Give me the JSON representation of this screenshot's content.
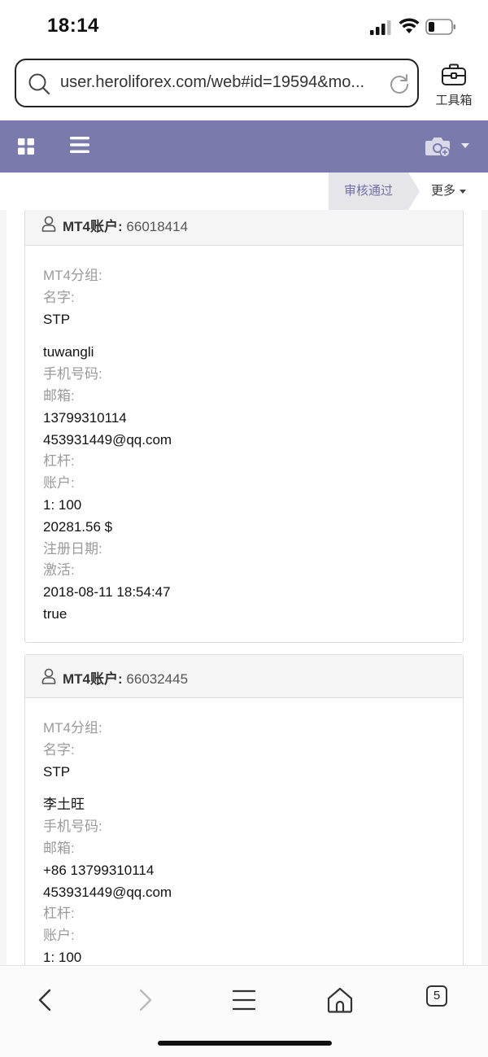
{
  "status": {
    "time": "18:14"
  },
  "browser": {
    "url": "user.heroliforex.com/web#id=19594&mo...",
    "toolbox_label": "工具箱"
  },
  "actions": {
    "approve": "审核通过",
    "more": "更多"
  },
  "accounts": [
    {
      "title_label": "MT4账户:",
      "number": "66018414",
      "lines": [
        {
          "text": "MT4分组:",
          "kind": "label"
        },
        {
          "text": "名字:",
          "kind": "label"
        },
        {
          "text": "STP",
          "kind": "value"
        },
        {
          "text": "tuwangli",
          "kind": "value",
          "gap": true
        },
        {
          "text": "手机号码:",
          "kind": "label"
        },
        {
          "text": "邮箱:",
          "kind": "label"
        },
        {
          "text": "13799310114",
          "kind": "value"
        },
        {
          "text": "453931449@qq.com",
          "kind": "value"
        },
        {
          "text": "杠杆:",
          "kind": "label"
        },
        {
          "text": "账户:",
          "kind": "label"
        },
        {
          "text": "1: 100",
          "kind": "value"
        },
        {
          "text": "20281.56 $",
          "kind": "value"
        },
        {
          "text": "注册日期:",
          "kind": "label"
        },
        {
          "text": "激活:",
          "kind": "label"
        },
        {
          "text": "2018-08-11 18:54:47",
          "kind": "value"
        },
        {
          "text": "true",
          "kind": "value"
        }
      ]
    },
    {
      "title_label": "MT4账户:",
      "number": "66032445",
      "lines": [
        {
          "text": "MT4分组:",
          "kind": "label"
        },
        {
          "text": "名字:",
          "kind": "label"
        },
        {
          "text": "STP",
          "kind": "value"
        },
        {
          "text": "李土旺",
          "kind": "value",
          "gap": true
        },
        {
          "text": "手机号码:",
          "kind": "label"
        },
        {
          "text": "邮箱:",
          "kind": "label"
        },
        {
          "text": "+86 13799310114",
          "kind": "value"
        },
        {
          "text": "453931449@qq.com",
          "kind": "value"
        },
        {
          "text": "杠杆:",
          "kind": "label"
        },
        {
          "text": "账户:",
          "kind": "label"
        },
        {
          "text": "1: 100",
          "kind": "value"
        }
      ]
    }
  ],
  "bottom_nav": {
    "tab_count": "5"
  },
  "colors": {
    "appbar": "#7b7aac",
    "approve_text": "#6f6fa7"
  }
}
